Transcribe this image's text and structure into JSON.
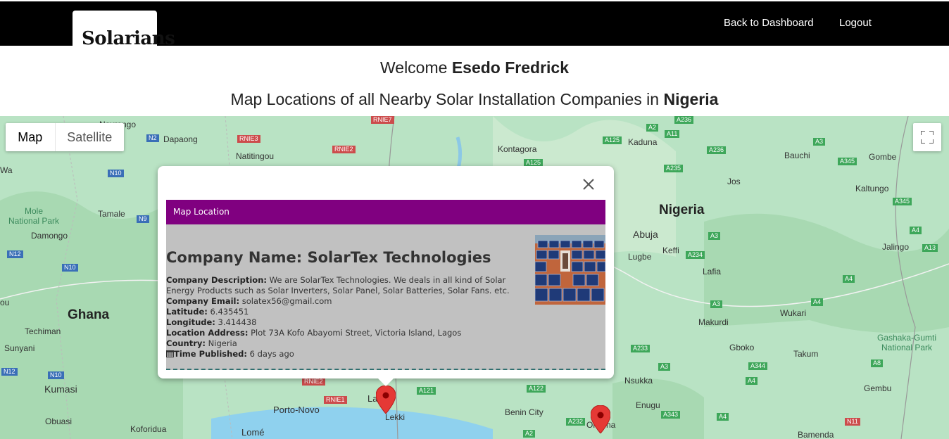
{
  "header": {
    "logo": "Solarians",
    "nav": {
      "dashboard": "Back to Dashboard",
      "logout": "Logout"
    }
  },
  "welcome": {
    "prefix": "Welcome ",
    "name": "Esedo Fredrick"
  },
  "subtitle": {
    "prefix": "Map Locations of all Nearby Solar Installation Companies in ",
    "country": "Nigeria"
  },
  "map": {
    "type_control": {
      "map": "Map",
      "satellite": "Satellite"
    },
    "countries": [
      "Nigeria",
      "Ghana"
    ],
    "cities": [
      "Tamale",
      "Damongo",
      "Natitingou",
      "Dapaong",
      "Kontagora",
      "Kaduna",
      "Bauchi",
      "Gombe",
      "Jos",
      "Kaltungo",
      "Abuja",
      "Keffi",
      "Lugbe",
      "Jalingo",
      "Lafia",
      "Makurdi",
      "Wukari",
      "Gboko",
      "Takum",
      "Techiman",
      "Sunyani",
      "Kumasi",
      "Obuasi",
      "Koforidua",
      "Lomé",
      "Porto-Novo",
      "Lagos",
      "Lekki",
      "Benin City",
      "Onitsha",
      "Nsukka",
      "Enugu",
      "Gembu",
      "Bamenda",
      "Wa",
      "ou",
      "Navrongo"
    ],
    "parks": [
      "Mole\nNational Park",
      "Gashaka-Gumti\nNational Park"
    ],
    "roads": [
      "RNIE7",
      "RNIE3",
      "RNIE2",
      "N2",
      "N10",
      "N9",
      "N12",
      "N10",
      "N12",
      "N10",
      "A2",
      "A11",
      "A236",
      "A125",
      "A236",
      "A235",
      "A3",
      "A345",
      "A345",
      "A125",
      "A234",
      "A3",
      "A4",
      "A13",
      "A4",
      "A3",
      "A4",
      "A233",
      "A344",
      "A8",
      "A3",
      "A4",
      "A122",
      "A121",
      "A232",
      "A343",
      "A2",
      "RNIE2",
      "RNIE1",
      "A4",
      "N11"
    ]
  },
  "infowindow": {
    "header": "Map Location",
    "company_name": "Company Name: SolarTex Technologies",
    "fields": [
      {
        "label": "Company Description:",
        "value": " We are SolarTex Technologies. We deals in all kind of Solar Energy Products such as Solar Inverters, Solar Panel, Solar Batteries, Solar Fans. etc."
      },
      {
        "label": "Company Email:",
        "value": " solatex56@gmail.com"
      },
      {
        "label": "Latitude:",
        "value": " 6.435451"
      },
      {
        "label": "Longitude:",
        "value": " 3.414438"
      },
      {
        "label": "Location Address:",
        "value": " Plot 73A Kofo Abayomi Street, Victoria Island, Lagos"
      },
      {
        "label": "Country:",
        "value": " Nigeria"
      },
      {
        "label": "Time Published:",
        "value": " 6 days ago"
      }
    ]
  },
  "colors": {
    "header_bg": "#000000",
    "infowindow_header": "#800080",
    "infowindow_body": "#c1c1c1",
    "pin": "#e53935"
  }
}
